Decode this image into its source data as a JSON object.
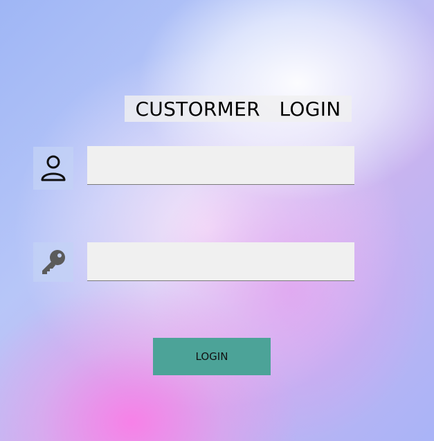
{
  "title": "CUSTORMER   LOGIN",
  "fields": {
    "username": {
      "icon": "user-icon",
      "value": "",
      "placeholder": ""
    },
    "password": {
      "icon": "key-icon",
      "value": "",
      "placeholder": ""
    }
  },
  "login_button": {
    "label": "LOGIN",
    "color": "#4ca398"
  }
}
